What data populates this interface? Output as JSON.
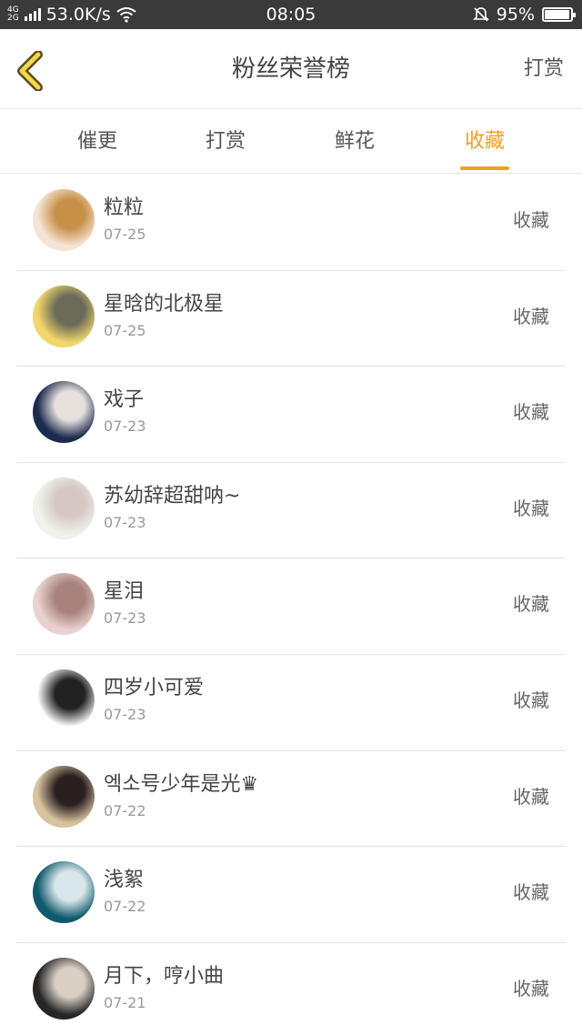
{
  "status_bar": {
    "network_top": "4G",
    "network_bottom": "2G",
    "speed": "53.0K/s",
    "time": "08:05",
    "battery": "95%",
    "battery_level": 0.95
  },
  "header": {
    "title": "粉丝荣誉榜",
    "action": "打赏"
  },
  "tabs": [
    {
      "label": "催更"
    },
    {
      "label": "打赏"
    },
    {
      "label": "鲜花"
    },
    {
      "label": "收藏",
      "active": true
    }
  ],
  "rows": [
    {
      "name": "粒粒",
      "date": "07-25",
      "kind": "收藏",
      "avatar_colors": [
        "#f4e6d6",
        "#c8914a"
      ]
    },
    {
      "name": "星晗的北极星",
      "date": "07-25",
      "kind": "收藏",
      "avatar_colors": [
        "#f2d66a",
        "#6b6b5a"
      ]
    },
    {
      "name": "戏子",
      "date": "07-23",
      "kind": "收藏",
      "avatar_colors": [
        "#1c2a4e",
        "#e7e1de"
      ]
    },
    {
      "name": "苏幼辞超甜呐~",
      "date": "07-23",
      "kind": "收藏",
      "avatar_colors": [
        "#eef3ec",
        "#d7c7c3"
      ]
    },
    {
      "name": "星泪",
      "date": "07-23",
      "kind": "收藏",
      "avatar_colors": [
        "#e9d2d0",
        "#a8827c"
      ]
    },
    {
      "name": "四岁小可爱",
      "date": "07-23",
      "kind": "收藏",
      "avatar_colors": [
        "#ffffff",
        "#222222"
      ]
    },
    {
      "name": "엑소号少年是光♛",
      "date": "07-22",
      "kind": "收藏",
      "avatar_colors": [
        "#d7c39f",
        "#2b2020"
      ]
    },
    {
      "name": "浅絮",
      "date": "07-22",
      "kind": "收藏",
      "avatar_colors": [
        "#0f5a6e",
        "#d9e7ea"
      ]
    },
    {
      "name": "月下，哼小曲",
      "date": "07-21",
      "kind": "收藏",
      "avatar_colors": [
        "#262626",
        "#d9cfc4"
      ]
    }
  ]
}
